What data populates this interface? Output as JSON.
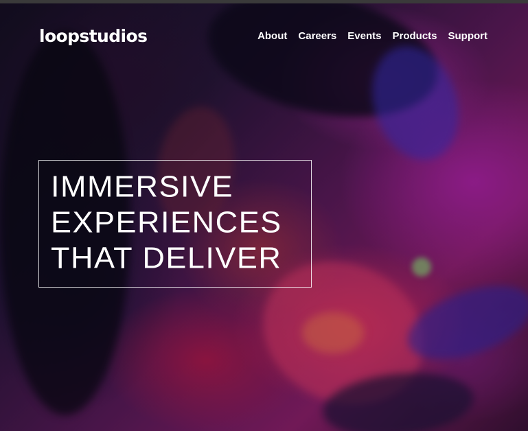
{
  "header": {
    "logo": "loopstudios",
    "nav": [
      "About",
      "Careers",
      "Events",
      "Products",
      "Support"
    ]
  },
  "hero": {
    "headline_lines": [
      "IMMERSIVE",
      "EXPERIENCES",
      "THAT DELIVER"
    ],
    "accent_colors": [
      "#8a1f6a",
      "#5a1a5a",
      "#27163a"
    ]
  }
}
